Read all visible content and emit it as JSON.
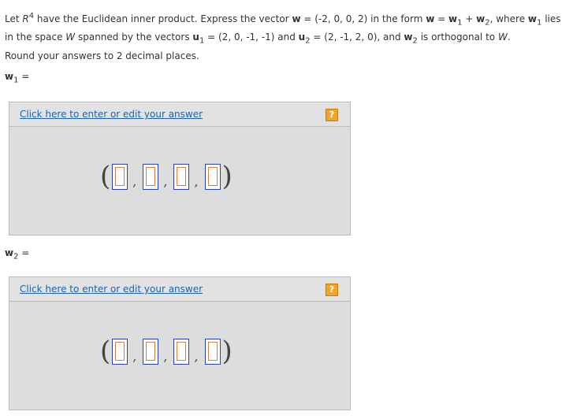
{
  "question": {
    "p1": "Let ",
    "R": "R",
    "sup4": "4",
    "p2": " have the Euclidean inner product. Express the vector ",
    "w": "w",
    "p3": " = (-2, 0, 0, 2) in the form ",
    "w_b": "w",
    "p4": " = ",
    "w1a": "w",
    "sub1a": "1",
    "p5": " + ",
    "w2a": "w",
    "sub2a": "2",
    "p6": ", where ",
    "w1b": "w",
    "sub1b": "1",
    "p7": " lies in the space ",
    "W": "W",
    "p8": " spanned by the vectors ",
    "u1": "u",
    "subu1": "1",
    "p9": " = (2, 0, -1, -1) and ",
    "u2": "u",
    "subu2": "2",
    "p10": " = (2, -1, 2, 0), and ",
    "w2b": "w",
    "sub2b": "2",
    "p11": " is orthogonal to ",
    "W2": "W",
    "p12": "."
  },
  "round_text": "Round your answers to 2 decimal places.",
  "answers": [
    {
      "label_var": "w",
      "label_sub": "1",
      "label_eq": " =",
      "link": "Click here to enter or edit your answer",
      "help": "?"
    },
    {
      "label_var": "w",
      "label_sub": "2",
      "label_eq": " =",
      "link": "Click here to enter or edit your answer",
      "help": "?"
    }
  ],
  "vector_glyphs": {
    "open": "(",
    "close": ")",
    "comma": ","
  }
}
